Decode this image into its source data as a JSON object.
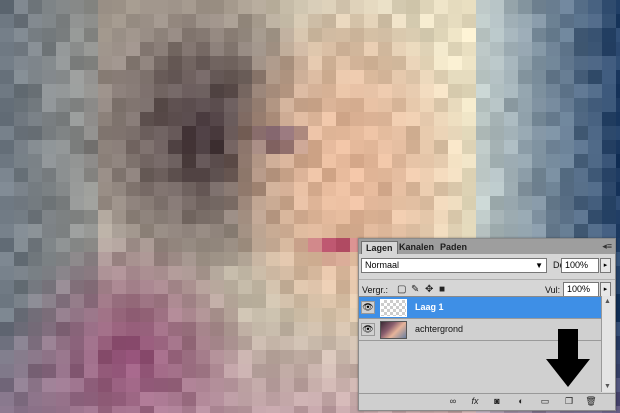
{
  "panel": {
    "tabs": [
      {
        "label": "Lagen",
        "active": true
      },
      {
        "label": "Kanalen",
        "active": false
      },
      {
        "label": "Paden",
        "active": false
      }
    ],
    "menu_icon": "panel-menu-icon",
    "blend_mode": "Normaal",
    "opacity_label": "Dekking:",
    "opacity_value": "100%",
    "lock_label": "Vergr.:",
    "fill_label": "Vul:",
    "fill_value": "100%",
    "layers": [
      {
        "name": "Laag 1",
        "selected": true,
        "visible": true,
        "thumb": "transparent"
      },
      {
        "name": "achtergrond",
        "selected": false,
        "visible": true,
        "thumb": "photo"
      }
    ],
    "bottom_icons": [
      "link-icon",
      "fx-icon",
      "mask-icon",
      "adjustment-icon",
      "folder-icon",
      "new-layer-icon",
      "trash-icon"
    ],
    "bottom_glyphs": {
      "link": "∞",
      "fx": "fx",
      "mask": "◙",
      "adjust": "◐",
      "folder": "▭",
      "newlayer": "❐",
      "trash": "🗑"
    }
  },
  "colors": {
    "panel_bg": "#d6d6d6",
    "selected_layer": "#3e8fe6",
    "arrow": "#000000"
  }
}
